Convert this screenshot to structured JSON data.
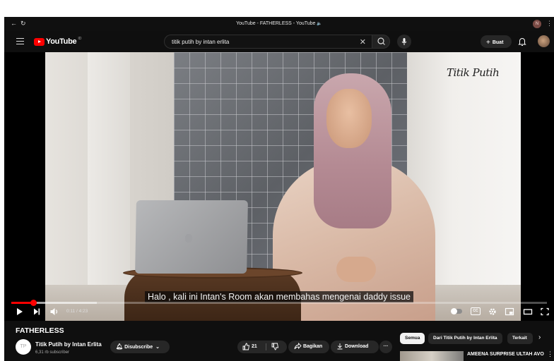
{
  "window": {
    "title": "YouTube - FATHERLESS - YouTube",
    "profile_initial": "N"
  },
  "header": {
    "logo_text": "YouTube",
    "logo_country": "ID",
    "search_query": "titik putih by intan erlita",
    "create_label": "Buat"
  },
  "video": {
    "watermark": "Titik Putih",
    "subtitle": "Halo , kali ini Intan's Room akan membahas mengenai daddy issue",
    "time_current": "0:11",
    "time_total": "4:23",
    "time_display": "0:11 / 4:23",
    "progress_fraction": 0.042,
    "buffered_fraction": 0.16,
    "cc_label": "CC"
  },
  "watch": {
    "title": "FATHERLESS",
    "channel_name": "Titik Putih by Intan Erlita",
    "channel_avatar_text": "TP",
    "subscribers": "6,31 rb subscriber",
    "subscribe_label": "Disubscribe",
    "like_count": "21",
    "share_label": "Bagikan",
    "download_label": "Download"
  },
  "sidebar": {
    "chips": [
      "Semua",
      "Dari Titik Putih by Intan Erlita",
      "Terkait"
    ],
    "recommendation_title": "AMEENA SURPRISE ULTAH AVO"
  },
  "colors": {
    "accent": "#ff0000",
    "background": "#0f0f0f",
    "chip_active": "#f1f1f1"
  },
  "icons": [
    "back-icon",
    "reload-icon",
    "menu-icon",
    "youtube-logo-icon",
    "search-icon",
    "clear-icon",
    "mic-icon",
    "plus-icon",
    "bell-icon",
    "play-icon",
    "next-icon",
    "volume-icon",
    "settings-icon",
    "miniplayer-icon",
    "theater-icon",
    "fullscreen-icon",
    "like-icon",
    "dislike-icon",
    "share-icon",
    "download-icon",
    "more-icon",
    "chevron-right-icon"
  ]
}
